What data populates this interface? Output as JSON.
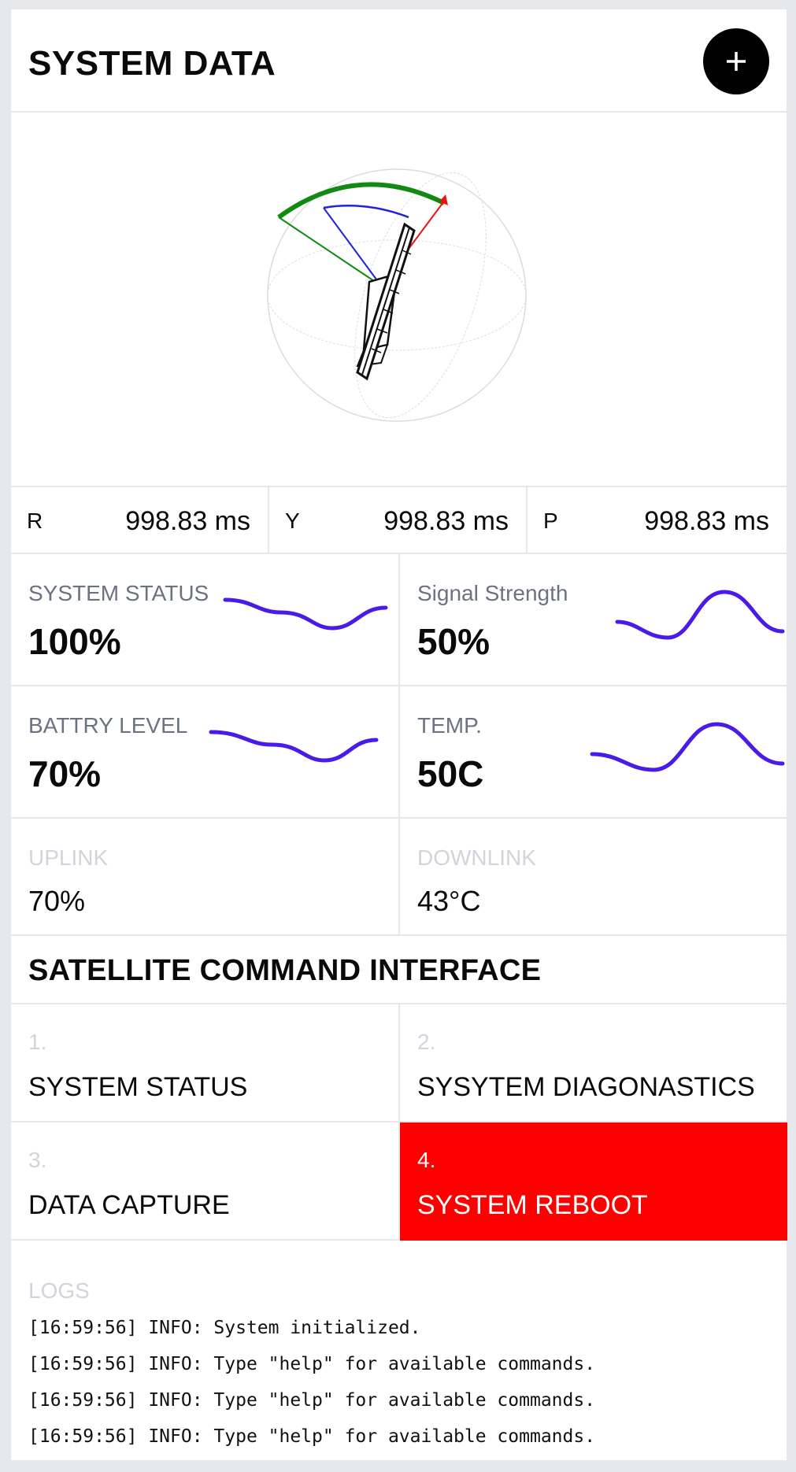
{
  "header": {
    "title": "SYSTEM DATA",
    "add_label": "+"
  },
  "ryp": [
    {
      "axis": "R",
      "value": "998.83 ms"
    },
    {
      "axis": "Y",
      "value": "998.83 ms"
    },
    {
      "axis": "P",
      "value": "998.83 ms"
    }
  ],
  "metrics": [
    {
      "label": "SYSTEM STATUS",
      "value": "100%"
    },
    {
      "label": "Signal Strength",
      "value": "50%"
    },
    {
      "label": "BATTRY LEVEL",
      "value": "70%"
    },
    {
      "label": "TEMP.",
      "value": "50C"
    }
  ],
  "links": [
    {
      "label": "UPLINK",
      "value": "70%"
    },
    {
      "label": "DOWNLINK",
      "value": "43°C"
    }
  ],
  "commands": {
    "title": "SATELLITE COMMAND INTERFACE",
    "items": [
      {
        "num": "1.",
        "name": "SYSTEM STATUS"
      },
      {
        "num": "2.",
        "name": "SYSYTEM DIAGONASTICS"
      },
      {
        "num": "3.",
        "name": "DATA CAPTURE"
      },
      {
        "num": "4.",
        "name": "SYSTEM REBOOT"
      }
    ]
  },
  "logs": {
    "label": "LOGS",
    "lines": [
      "[16:59:56] INFO: System initialized.",
      "[16:59:56] INFO: Type \"help\" for available commands.",
      "[16:59:56] INFO: Type \"help\" for available commands.",
      "[16:59:56] INFO: Type \"help\" for available commands."
    ]
  },
  "colors": {
    "accent": "#4a1be8",
    "danger": "#ff0000",
    "divider": "#e5e7eb"
  }
}
